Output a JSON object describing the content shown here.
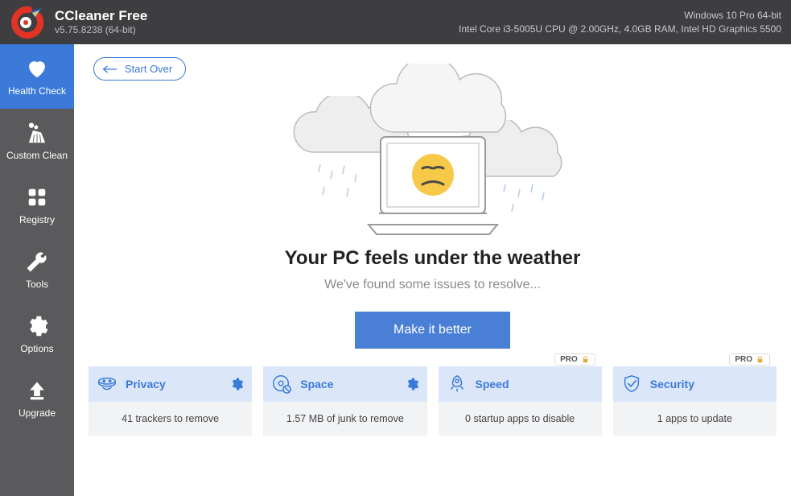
{
  "header": {
    "title": "CCleaner Free",
    "version": "v5.75.8238 (64-bit)",
    "os": "Windows 10 Pro 64-bit",
    "hw": "Intel Core i3-5005U CPU @ 2.00GHz, 4.0GB RAM, Intel HD Graphics 5500"
  },
  "sidebar": {
    "items": [
      {
        "label": "Health Check"
      },
      {
        "label": "Custom Clean"
      },
      {
        "label": "Registry"
      },
      {
        "label": "Tools"
      },
      {
        "label": "Options"
      },
      {
        "label": "Upgrade"
      }
    ]
  },
  "main": {
    "start_over": "Start Over",
    "headline": "Your PC feels under the weather",
    "subline": "We've found some issues to resolve...",
    "cta": "Make it better"
  },
  "cards": [
    {
      "title": "Privacy",
      "detail": "41 trackers to remove",
      "gear": true,
      "pro": false
    },
    {
      "title": "Space",
      "detail": "1.57 MB of junk to remove",
      "gear": true,
      "pro": false
    },
    {
      "title": "Speed",
      "detail": "0 startup apps to disable",
      "gear": false,
      "pro": true
    },
    {
      "title": "Security",
      "detail": "1 apps to update",
      "gear": false,
      "pro": true
    }
  ],
  "pro_label": "PRO"
}
